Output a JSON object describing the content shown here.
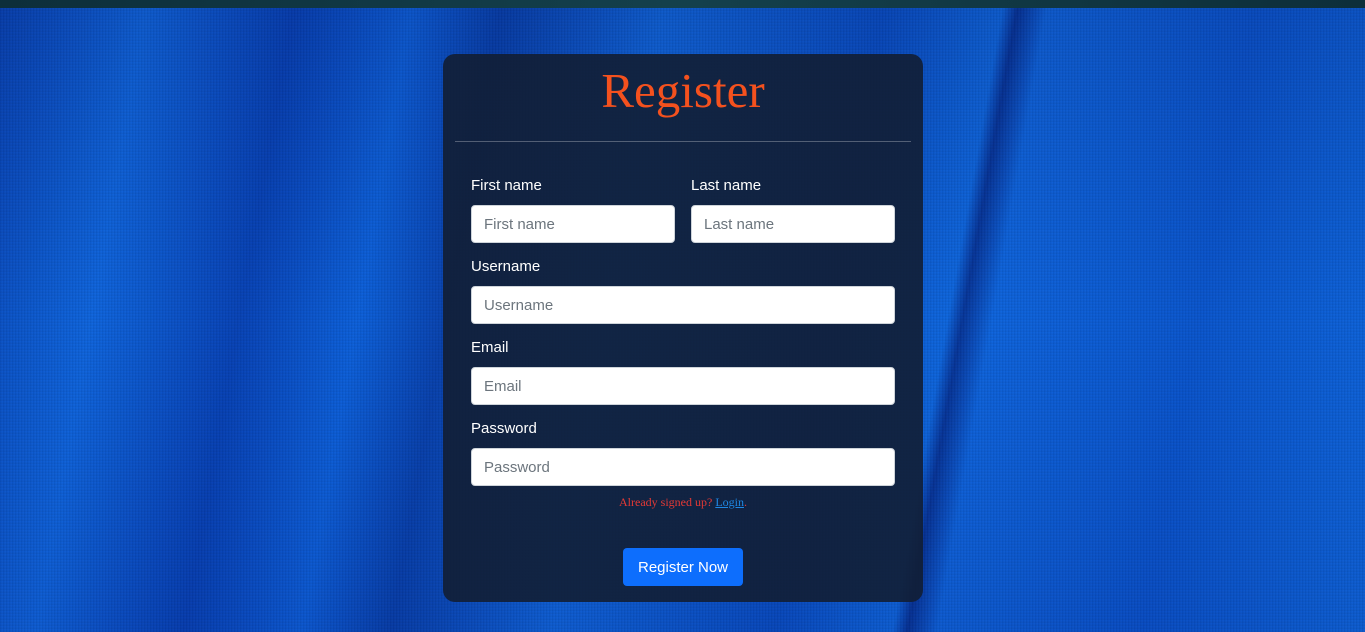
{
  "page": {
    "title": "Register"
  },
  "form": {
    "first_name": {
      "label": "First name",
      "placeholder": "First name",
      "value": ""
    },
    "last_name": {
      "label": "Last name",
      "placeholder": "Last name",
      "value": ""
    },
    "username": {
      "label": "Username",
      "placeholder": "Username",
      "value": ""
    },
    "email": {
      "label": "Email",
      "placeholder": "Email",
      "value": ""
    },
    "password": {
      "label": "Password",
      "placeholder": "Password",
      "value": ""
    }
  },
  "signin": {
    "prompt": "Already signed up? ",
    "link_label": "Login",
    "suffix": "."
  },
  "submit": {
    "label": "Register Now"
  },
  "colors": {
    "title": "#f4511e",
    "button": "#0d6efd",
    "card_bg": "#121e34",
    "note": "#e53935",
    "link": "#1e88e5"
  }
}
